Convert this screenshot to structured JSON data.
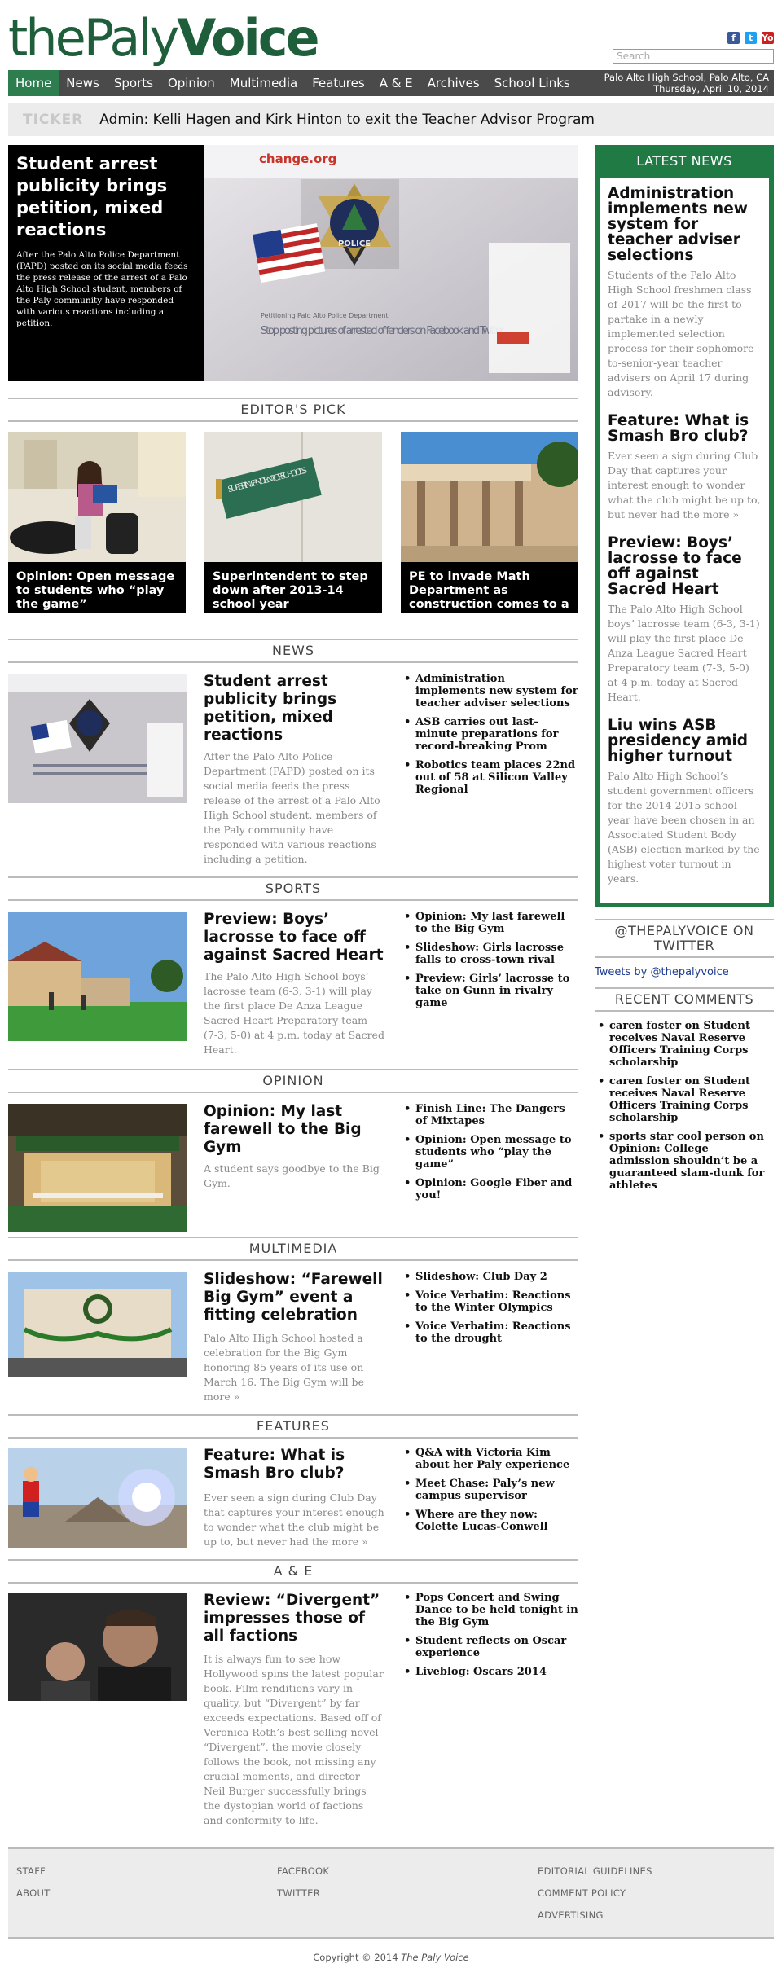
{
  "site": {
    "logo_the": "the",
    "logo_paly": "Paly",
    "logo_voice": "Voice",
    "search_placeholder": "Search",
    "location": "Palo Alto High School, Palo Alto, CA",
    "date": "Thursday, April 10, 2014",
    "colors": {
      "brand_green": "#1f7a44",
      "nav_bg": "#4a4a4a",
      "nav_active": "#2e7d4f"
    }
  },
  "social": {
    "facebook": "f",
    "twitter": "t",
    "youtube": "You"
  },
  "nav": [
    "Home",
    "News",
    "Sports",
    "Opinion",
    "Multimedia",
    "Features",
    "A & E",
    "Archives",
    "School Links"
  ],
  "ticker": {
    "label": "TICKER",
    "text": "Admin: Kelli Hagen and Kirk Hinton to exit the Teacher Advisor Program"
  },
  "hero": {
    "title": "Student arrest publicity brings petition, mixed reactions",
    "summary": "After the Palo Alto Police Department (PAPD) posted on its social media feeds the press release of the arrest of a Palo Alto High School student, members of the Paly community have responded with various reactions including a petition.",
    "image_text_site": "change.org",
    "image_text_police": "POLICE",
    "image_text_petitioning": "Petitioning Palo Alto Police Department",
    "image_text_headline": "Stop posting pictures of arrested offenders on Facebook and Twitter."
  },
  "editors_pick": {
    "heading": "EDITOR'S PICK",
    "items": [
      {
        "caption": "Opinion: Open message to students who “play the game”"
      },
      {
        "caption": "Superintendent to step down after 2013-14 school year",
        "sign_text": "SUPERINTENDENT OF SCHOOLS"
      },
      {
        "caption": "PE to invade Math Department as construction comes to a"
      }
    ]
  },
  "sections": [
    {
      "heading": "NEWS",
      "title": "Student arrest publicity brings petition, mixed reactions",
      "body": "After the Palo Alto Police Department (PAPD) posted on its social media feeds the press release of the arrest of a Palo Alto High School student, members of the Paly community have responded with various reactions including a petition.",
      "links": [
        "Administration implements new system for teacher adviser selections",
        "ASB carries out last-minute preparations for record-breaking Prom",
        "Robotics team places 22nd out of 58 at Silicon Valley Regional"
      ]
    },
    {
      "heading": "SPORTS",
      "title": "Preview: Boys’ lacrosse to face off against Sacred Heart",
      "body": "The Palo Alto High School boys’ lacrosse team (6-3, 3-1) will play the first place De Anza League Sacred Heart Preparatory team (7-3, 5-0) at 4 p.m. today at Sacred Heart.",
      "links": [
        "Opinion: My last farewell to the Big Gym",
        "Slideshow: Girls lacrosse falls to cross-town rival",
        "Preview: Girls’ lacrosse to take on Gunn in rivalry game"
      ]
    },
    {
      "heading": "OPINION",
      "title": "Opinion: My last farewell to the Big Gym",
      "body": "A student says goodbye to the Big Gym.",
      "links": [
        "Finish Line: The Dangers of Mixtapes",
        "Opinion: Open message to students who “play the game”",
        "Opinion: Google Fiber and you!"
      ]
    },
    {
      "heading": "MULTIMEDIA",
      "title": "Slideshow: “Farewell Big Gym” event a fitting celebration",
      "body": "Palo Alto High School hosted a celebration for the Big Gym honoring 85 years of its use on March 16. The Big Gym will be more »",
      "links": [
        "Slideshow: Club Day 2",
        "Voice Verbatim: Reactions to the Winter Olympics",
        "Voice Verbatim: Reactions to the drought"
      ]
    },
    {
      "heading": "FEATURES",
      "title": "Feature: What is Smash Bro club?",
      "body": "Ever seen a sign during Club Day that captures your interest enough to wonder what the club might be up to, but never had the more »",
      "links": [
        "Q&A with Victoria Kim about her Paly experience",
        "Meet Chase: Paly’s new campus supervisor",
        "Where are they now: Colette Lucas-Conwell"
      ]
    },
    {
      "heading": "A & E",
      "title": "Review: “Divergent” impresses those of all factions",
      "body": "It is always fun to see how Hollywood spins the latest popular book. Film renditions vary in quality, but “Divergent” by far exceeds expectations. Based off of Veronica Roth’s best-selling novel “Divergent”, the movie closely follows the book, not missing any crucial moments, and director Neil Burger successfully brings the dystopian world of factions and conformity to life.",
      "links": [
        "Pops Concert and Swing Dance to be held tonight in the Big Gym",
        "Student reflects on Oscar experience",
        "Liveblog: Oscars 2014"
      ]
    }
  ],
  "latest_news": {
    "heading": "LATEST NEWS",
    "items": [
      {
        "title": "Administration implements new system for teacher adviser selections",
        "body": "Students of the Palo Alto High School freshmen class of 2017 will be the first to partake in a newly implemented selection process for their sophomore-to-senior-year teacher advisers on April 17 during advisory."
      },
      {
        "title": "Feature: What is Smash Bro club?",
        "body": "Ever seen a sign during Club Day that captures your interest enough to wonder what the club might be up to, but never had the more »"
      },
      {
        "title": "Preview: Boys’ lacrosse to face off against Sacred Heart",
        "body": "The Palo Alto High School boys’ lacrosse team (6-3, 3-1) will play the first place De Anza League Sacred Heart Preparatory team (7-3, 5-0) at 4 p.m. today at Sacred Heart."
      },
      {
        "title": "Liu wins ASB presidency amid higher turnout",
        "body": "Palo Alto High School’s student government officers for the 2014-2015 school year have been chosen in an Associated Student Body (ASB) election marked by the highest voter turnout in years."
      }
    ]
  },
  "twitter": {
    "heading": "@THEPALYVOICE ON TWITTER",
    "link": "Tweets by @thepalyvoice"
  },
  "recent_comments": {
    "heading": "RECENT COMMENTS",
    "items": [
      "caren foster on Student receives Naval Reserve Officers Training Corps scholarship",
      "caren foster on Student receives Naval Reserve Officers Training Corps scholarship",
      "sports star cool person on Opinion: College admission shouldn’t be a guaranteed slam-dunk for athletes"
    ]
  },
  "footer": {
    "col1": [
      "STAFF",
      "ABOUT"
    ],
    "col2": [
      "FACEBOOK",
      "TWITTER"
    ],
    "col3": [
      "EDITORIAL GUIDELINES",
      "COMMENT POLICY",
      "ADVERTISING"
    ],
    "copyright_prefix": "Copyright © 2014",
    "copyright_name": "The Paly Voice"
  }
}
